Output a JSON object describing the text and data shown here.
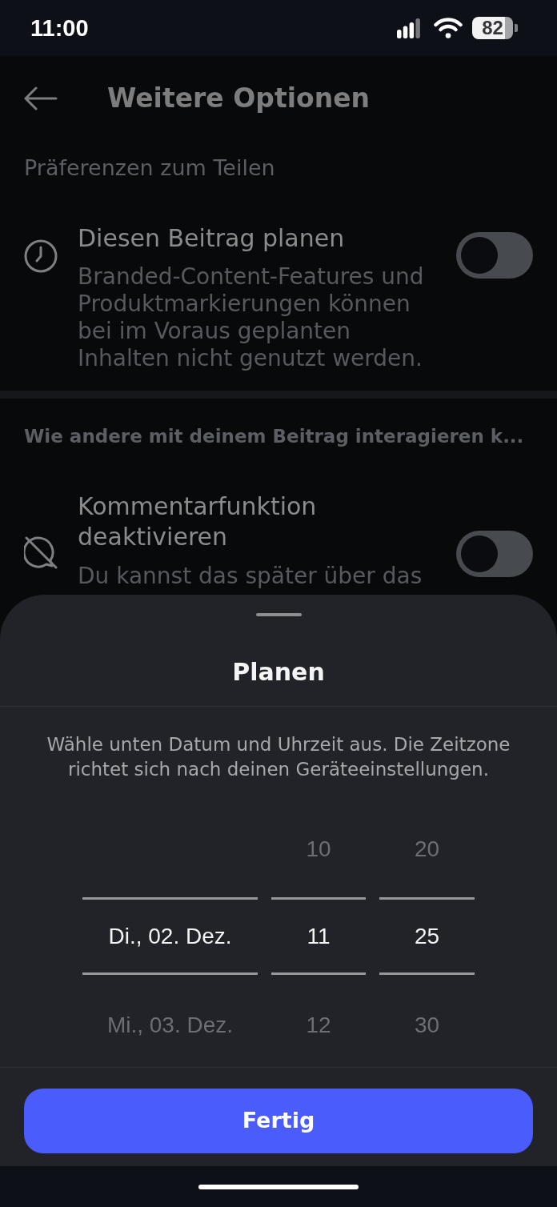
{
  "status_bar": {
    "time": "11:00",
    "battery": "82"
  },
  "header": {
    "title": "Weitere Optionen"
  },
  "sections": [
    {
      "title": "Präferenzen zum Teilen",
      "rows": [
        {
          "title": "Diesen Beitrag planen",
          "description": "Branded-Content-Features und Produktmarkierungen können bei im Voraus geplanten Inhalten nicht genutzt werden.",
          "on": false
        }
      ]
    },
    {
      "title": "Wie andere mit deinem Beitrag interagieren k...",
      "rows": [
        {
          "title": "Kommentarfunktion deaktivieren",
          "description": "Du kannst das später über das",
          "on": false
        }
      ]
    }
  ],
  "sheet": {
    "title": "Planen",
    "description": "Wähle unten Datum und Uhrzeit aus. Die Zeitzone richtet sich nach deinen Geräteeinstellungen.",
    "picker": {
      "columns": [
        {
          "items": [
            {
              "text": "Di., 02. Dez.",
              "selected": true
            },
            {
              "text": "Mi., 03. Dez.",
              "selected": false
            }
          ]
        },
        {
          "items": [
            {
              "text": "10",
              "selected": false
            },
            {
              "text": "11",
              "selected": true
            },
            {
              "text": "12",
              "selected": false
            }
          ]
        },
        {
          "items": [
            {
              "text": "20",
              "selected": false
            },
            {
              "text": "25",
              "selected": true
            },
            {
              "text": "30",
              "selected": false
            }
          ]
        }
      ]
    },
    "button": "Fertig"
  }
}
